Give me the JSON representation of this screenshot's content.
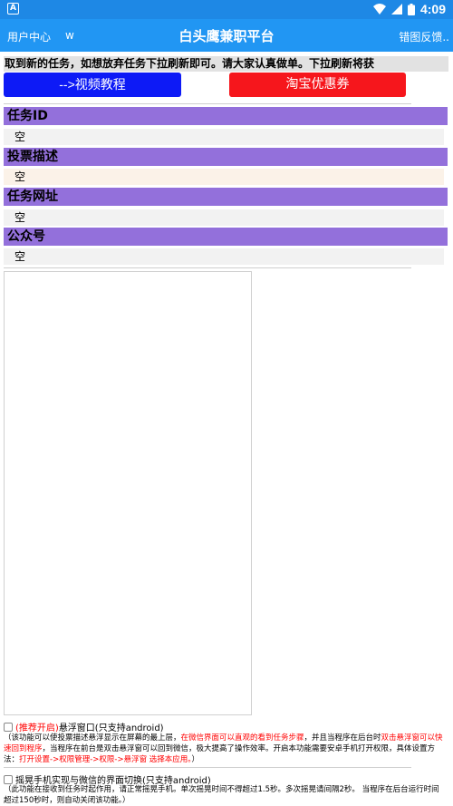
{
  "status": {
    "app_icon": "A",
    "time": "4:09"
  },
  "topbar": {
    "user_center": "用户中心",
    "w_label": "w",
    "title": "白头鹰兼职平台",
    "feedback": "错图反馈.."
  },
  "notice": "取到新的任务，如想放弃任务下拉刷新即可。请大家认真做单。下拉刷新将获",
  "buttons": {
    "video": "-->视频教程",
    "taobao": "淘宝优惠券"
  },
  "fields": [
    {
      "label": "任务ID",
      "value": "空"
    },
    {
      "label": "投票描述",
      "value": "空"
    },
    {
      "label": "任务网址",
      "value": "空"
    },
    {
      "label": "公众号",
      "value": "空"
    }
  ],
  "options": {
    "float": {
      "recommend": "(推荐开启)",
      "label": "悬浮窗口(只支持android)",
      "desc_1": "（该功能可以使投票描述悬浮显示在屏幕的最上层，",
      "desc_2_red": "在微信界面可以直观的看到任务步骤",
      "desc_3": "，并且当程序在后台时",
      "desc_4_red": "双击悬浮窗可以快速回到程序",
      "desc_5": "，当程序在前台是双击悬浮窗可以回到微信，极大提高了操作效率。开启本功能需要安卓手机打开权限，具体设置方法：",
      "desc_6_red": "打开设置->权限管理->权限->悬浮窗 选择本应用。",
      "desc_7": "）"
    },
    "shake": {
      "label": "摇晃手机实现与微信的界面切换(只支持android)",
      "desc": "（此功能在接收到任务时起作用，请正常摇晃手机。单次摇晃时间不得超过1.5秒。多次摇晃请间隔2秒。 当程序在后台运行时间超过150秒时，则自动关闭该功能。）"
    }
  },
  "colors": {
    "statusbar": "#1E88E5",
    "topbar": "#2196F3",
    "field_header": "#9370DB",
    "video_button": "#0D1AF6",
    "taobao_button": "#F6161C"
  }
}
